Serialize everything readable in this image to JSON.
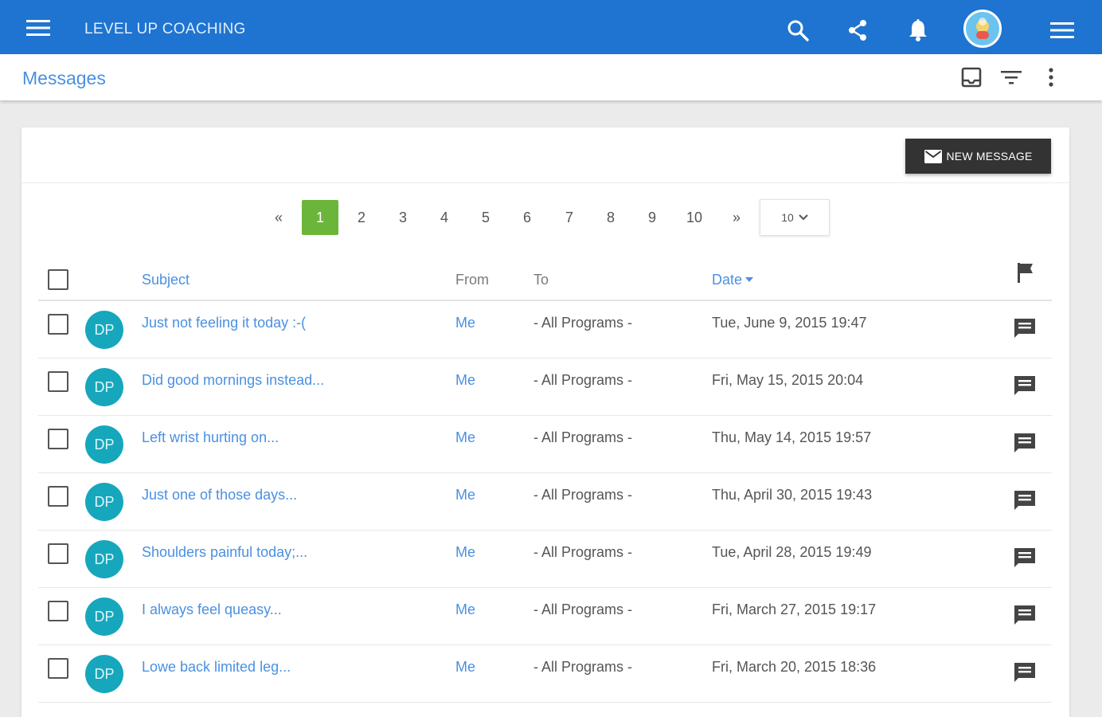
{
  "app_bar": {
    "title": "LEVEL UP COACHING",
    "icons": [
      "menu-icon",
      "search-icon",
      "share-icon",
      "notifications-icon",
      "avatar",
      "menu-icon"
    ],
    "color": "#1e74d0"
  },
  "sub_header": {
    "title": "Messages",
    "icons": [
      "inbox-icon",
      "filter-icon",
      "more-vert-icon"
    ]
  },
  "toolbar": {
    "new_message_label": "NEW MESSAGE"
  },
  "pagination": {
    "first": "«",
    "pages": [
      "1",
      "2",
      "3",
      "4",
      "5",
      "6",
      "7",
      "8",
      "9",
      "10"
    ],
    "active_page": "1",
    "last": "»",
    "per_page": "10",
    "active_color": "#6cb53b"
  },
  "table": {
    "headers": {
      "subject": "Subject",
      "from": "From",
      "to": "To",
      "date": "Date"
    },
    "rows": [
      {
        "initials": "DP",
        "subject": "Just not feeling it today :-(",
        "from": "Me",
        "to": "- All Programs -",
        "date": "Tue, June 9, 2015 19:47"
      },
      {
        "initials": "DP",
        "subject": "Did good mornings instead...",
        "from": "Me",
        "to": "- All Programs -",
        "date": "Fri, May 15, 2015 20:04"
      },
      {
        "initials": "DP",
        "subject": "Left wrist hurting on...",
        "from": "Me",
        "to": "- All Programs -",
        "date": "Thu, May 14, 2015 19:57"
      },
      {
        "initials": "DP",
        "subject": "Just one of those days...",
        "from": "Me",
        "to": "- All Programs -",
        "date": "Thu, April 30, 2015 19:43"
      },
      {
        "initials": "DP",
        "subject": "Shoulders painful today;...",
        "from": "Me",
        "to": "- All Programs -",
        "date": "Tue, April 28, 2015 19:49"
      },
      {
        "initials": "DP",
        "subject": "I always feel queasy...",
        "from": "Me",
        "to": "- All Programs -",
        "date": "Fri, March 27, 2015 19:17"
      },
      {
        "initials": "DP",
        "subject": "Lowe back limited leg...",
        "from": "Me",
        "to": "- All Programs -",
        "date": "Fri, March 20, 2015 18:36"
      }
    ]
  }
}
